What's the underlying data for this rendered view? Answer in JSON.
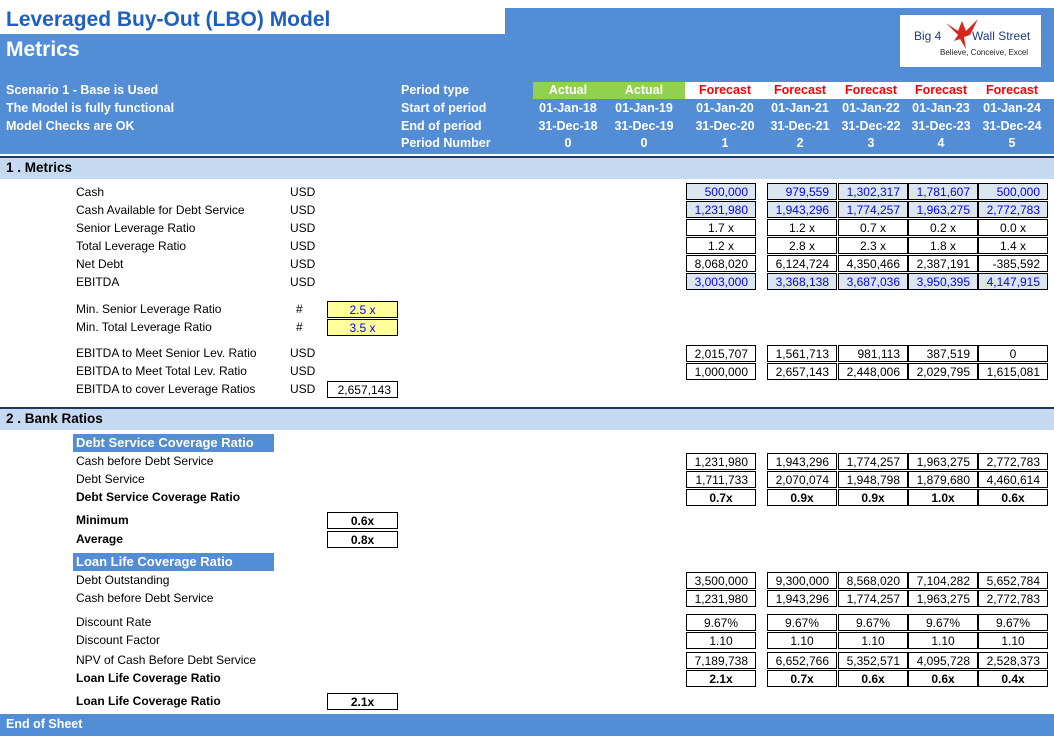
{
  "header": {
    "title": "Leveraged Buy-Out (LBO) Model",
    "subtitle": "Metrics",
    "status": [
      "Scenario 1 - Base is Used",
      "The Model is fully functional",
      "Model Checks are OK"
    ],
    "logo": {
      "line1": "Big 4",
      "line2": "Wall Street",
      "tagline": "Believe, Conceive, Excel"
    }
  },
  "periods": {
    "labels": [
      "Period type",
      "Start of period",
      "End of period",
      "Period Number"
    ],
    "columns": [
      {
        "type": "Actual",
        "start": "01-Jan-18",
        "end": "31-Dec-18",
        "num": "0"
      },
      {
        "type": "Actual",
        "start": "01-Jan-19",
        "end": "31-Dec-19",
        "num": "0"
      },
      {
        "type": "Forecast",
        "start": "01-Jan-20",
        "end": "31-Dec-20",
        "num": "1"
      },
      {
        "type": "Forecast",
        "start": "01-Jan-21",
        "end": "31-Dec-21",
        "num": "2"
      },
      {
        "type": "Forecast",
        "start": "01-Jan-22",
        "end": "31-Dec-22",
        "num": "3"
      },
      {
        "type": "Forecast",
        "start": "01-Jan-23",
        "end": "31-Dec-23",
        "num": "4"
      },
      {
        "type": "Forecast",
        "start": "01-Jan-24",
        "end": "31-Dec-24",
        "num": "5"
      }
    ]
  },
  "sections": {
    "metrics": "1 . Metrics",
    "bank": "2 . Bank Ratios",
    "end": "End of Sheet"
  },
  "metrics": {
    "rows": [
      {
        "label": "Cash",
        "unit": "USD",
        "values": [
          "500,000",
          "979,559",
          "1,302,317",
          "1,781,607",
          "500,000"
        ]
      },
      {
        "label": "Cash Available for Debt Service",
        "unit": "USD",
        "values": [
          "1,231,980",
          "1,943,296",
          "1,774,257",
          "1,963,275",
          "2,772,783"
        ]
      },
      {
        "label": "Senior Leverage Ratio",
        "unit": "USD",
        "values": [
          "1.7 x",
          "1.2 x",
          "0.7 x",
          "0.2 x",
          "0.0 x"
        ]
      },
      {
        "label": "Total Leverage Ratio",
        "unit": "USD",
        "values": [
          "1.2 x",
          "2.8 x",
          "2.3 x",
          "1.8 x",
          "1.4 x"
        ]
      },
      {
        "label": "Net Debt",
        "unit": "USD",
        "values": [
          "8,068,020",
          "6,124,724",
          "4,350,466",
          "2,387,191",
          "-385,592"
        ]
      },
      {
        "label": "EBITDA",
        "unit": "USD",
        "values": [
          "3,003,000",
          "3,368,138",
          "3,687,036",
          "3,950,395",
          "4,147,915"
        ]
      }
    ],
    "inputs": [
      {
        "label": "Min. Senior Leverage Ratio",
        "unit": "#",
        "value": "2.5 x"
      },
      {
        "label": "Min. Total Leverage Ratio",
        "unit": "#",
        "value": "3.5 x"
      }
    ],
    "ebitda_rows": [
      {
        "label": "EBITDA to Meet Senior Lev. Ratio",
        "unit": "USD",
        "values": [
          "2,015,707",
          "1,561,713",
          "981,113",
          "387,519",
          "0"
        ]
      },
      {
        "label": "EBITDA to Meet Total Lev. Ratio",
        "unit": "USD",
        "values": [
          "1,000,000",
          "2,657,143",
          "2,448,006",
          "2,029,795",
          "1,615,081"
        ]
      }
    ],
    "ebitda_cover": {
      "label": "EBITDA to cover Leverage Ratios",
      "unit": "USD",
      "value": "2,657,143"
    }
  },
  "dscr": {
    "title": "Debt Service Coverage Ratio",
    "rows": [
      {
        "label": "Cash before Debt Service",
        "values": [
          "1,231,980",
          "1,943,296",
          "1,774,257",
          "1,963,275",
          "2,772,783"
        ]
      },
      {
        "label": "Debt Service",
        "values": [
          "1,711,733",
          "2,070,074",
          "1,948,798",
          "1,879,680",
          "4,460,614"
        ]
      },
      {
        "label": "Debt Service Coverage Ratio",
        "values": [
          "0.7x",
          "0.9x",
          "0.9x",
          "1.0x",
          "0.6x"
        ]
      }
    ],
    "minimum": {
      "label": "Minimum",
      "value": "0.6x"
    },
    "average": {
      "label": "Average",
      "value": "0.8x"
    }
  },
  "llcr": {
    "title": "Loan Life Coverage Ratio",
    "rows_a": [
      {
        "label": "Debt Outstanding",
        "values": [
          "3,500,000",
          "9,300,000",
          "8,568,020",
          "7,104,282",
          "5,652,784"
        ]
      },
      {
        "label": "Cash before Debt Service",
        "values": [
          "1,231,980",
          "1,943,296",
          "1,774,257",
          "1,963,275",
          "2,772,783"
        ]
      }
    ],
    "rows_b": [
      {
        "label": "Discount Rate",
        "values": [
          "9.67%",
          "9.67%",
          "9.67%",
          "9.67%",
          "9.67%"
        ]
      },
      {
        "label": "Discount Factor",
        "values": [
          "1.10",
          "1.10",
          "1.10",
          "1.10",
          "1.10"
        ]
      }
    ],
    "rows_c": [
      {
        "label": "NPV of Cash Before Debt Service",
        "values": [
          "7,189,738",
          "6,652,766",
          "5,352,571",
          "4,095,728",
          "2,528,373"
        ]
      },
      {
        "label": "Loan Life Coverage Ratio",
        "values": [
          "2.1x",
          "0.7x",
          "0.6x",
          "0.6x",
          "0.4x"
        ]
      }
    ],
    "summary": {
      "label": "Loan Life Coverage Ratio",
      "value": "2.1x"
    }
  },
  "colors": {
    "header_blue": "#538dd5",
    "band": "#c5d9f1",
    "actual_green": "#92d050",
    "forecast_red": "#ff0000",
    "input_yellow": "#ffff99",
    "input_blue": "#0000ff"
  }
}
